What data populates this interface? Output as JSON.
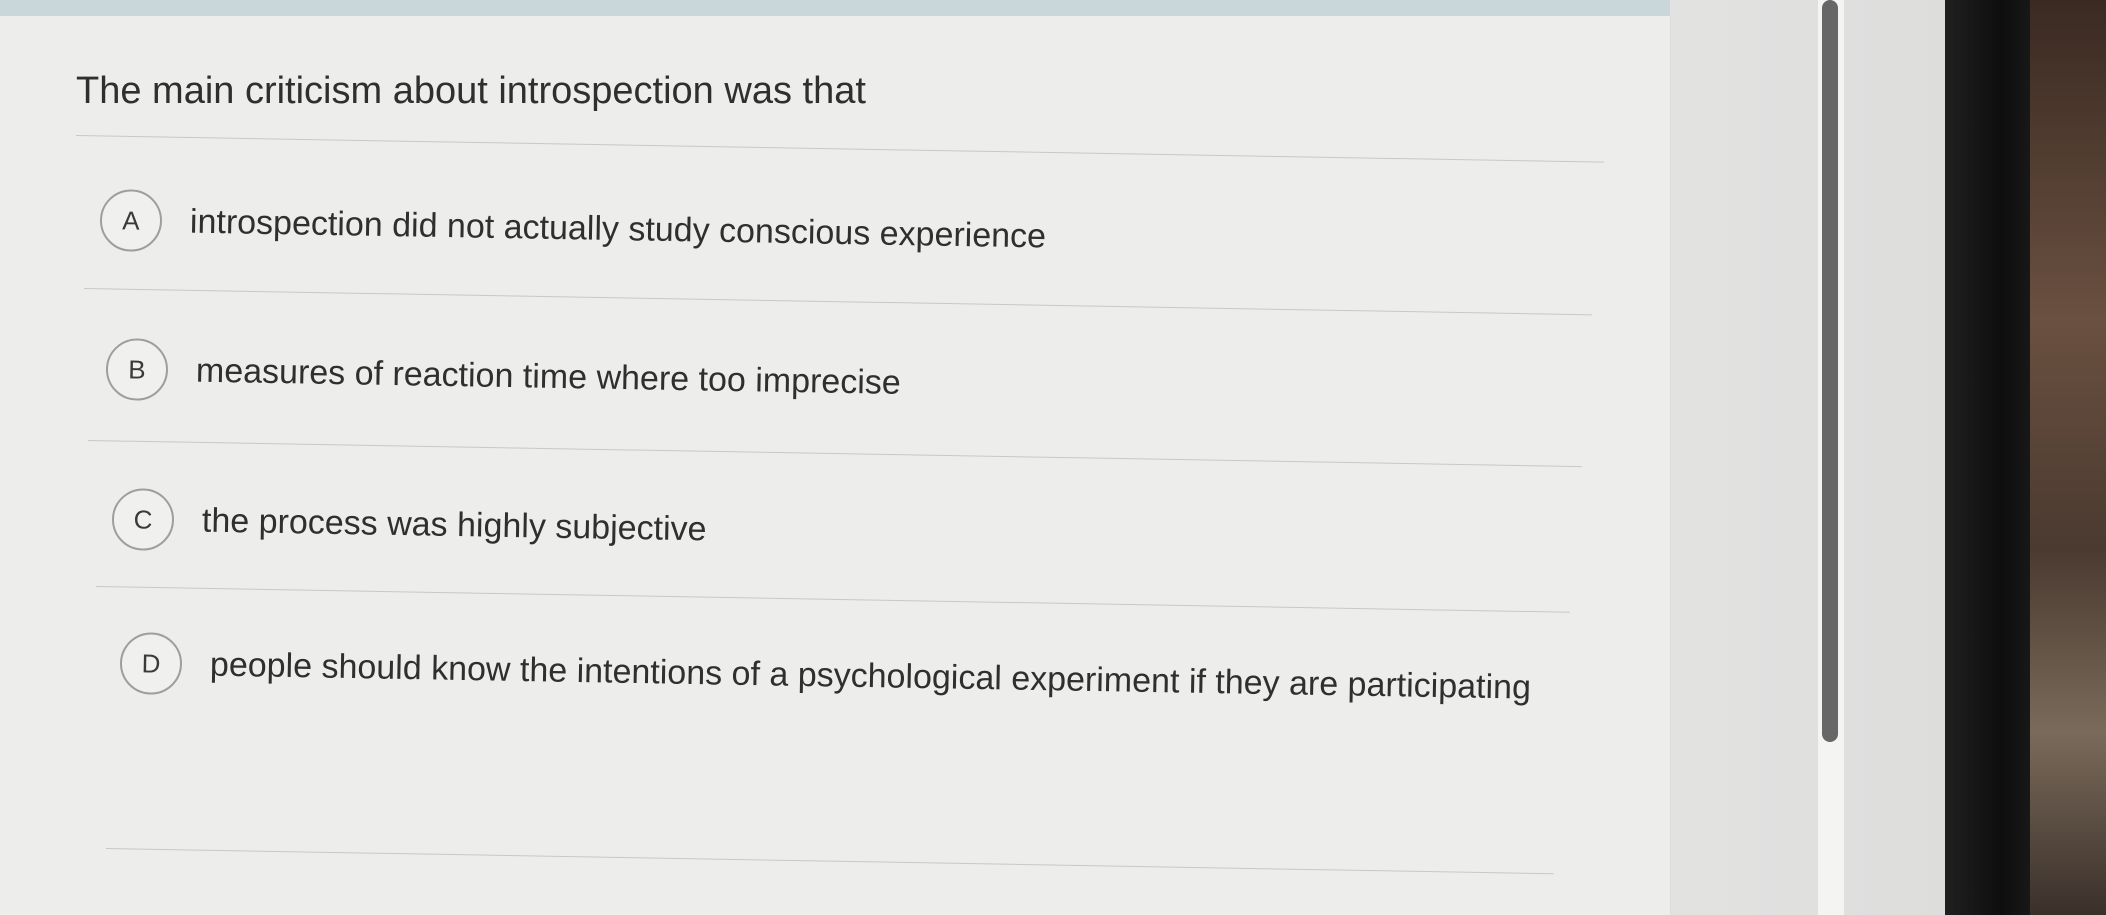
{
  "question": {
    "text": "The main criticism about introspection was that"
  },
  "options": [
    {
      "letter": "A",
      "text": "introspection did not actually study conscious experience"
    },
    {
      "letter": "B",
      "text": "measures of reaction time where too imprecise"
    },
    {
      "letter": "C",
      "text": "the process was highly subjective"
    },
    {
      "letter": "D",
      "text": "people should know the intentions of a psychological experiment if they are participating"
    }
  ],
  "colors": {
    "panel_background": "#ededec",
    "text": "#2f2f2f",
    "circle_border": "#9e9e9d",
    "divider": "#c8c8c7",
    "scrollbar_thumb": "#676767"
  }
}
